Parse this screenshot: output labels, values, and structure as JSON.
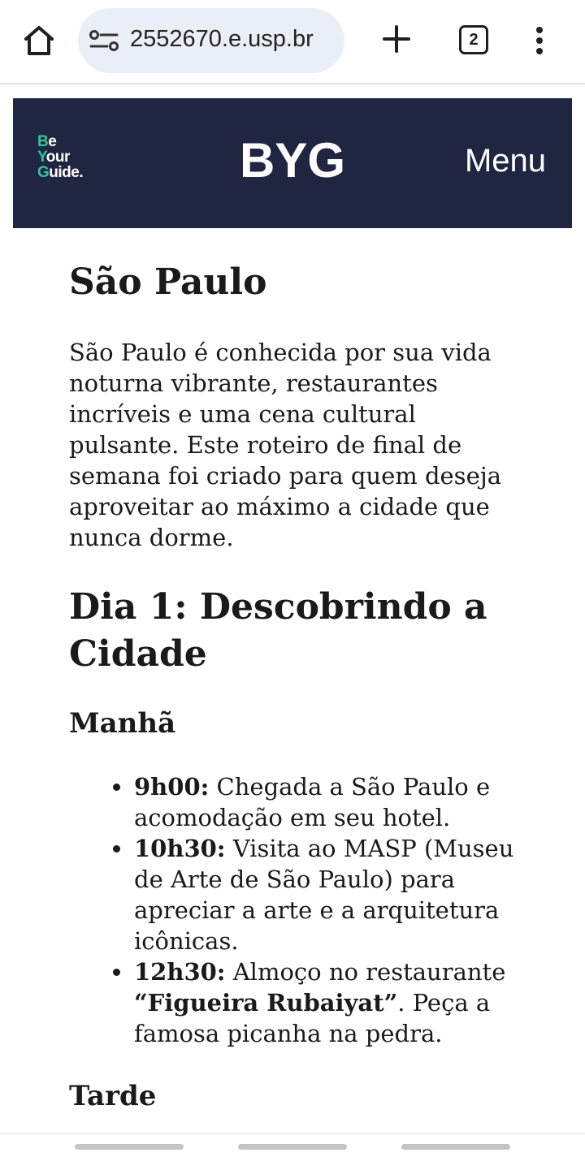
{
  "browser": {
    "url": "2552670.e.usp.br",
    "tab_count": "2"
  },
  "site": {
    "logo_lines": [
      "Be",
      "Your",
      "Guide."
    ],
    "brand": "BYG",
    "menu_label": "Menu",
    "header_color": "#202641",
    "logo_accent": "#2ec79a"
  },
  "article": {
    "title": "São Paulo",
    "intro": "São Paulo é conhecida por sua vida noturna vibrante, restaurantes incríveis e uma cena cultural pulsante. Este roteiro de final de semana foi criado para quem deseja aproveitar ao máximo a cidade que nunca dorme.",
    "day1_heading": "Dia 1: Descobrindo a Cidade",
    "morning_heading": "Manhã",
    "morning_items": [
      {
        "time": "9h00:",
        "text": " Chegada a São Paulo e acomodação em seu hotel."
      },
      {
        "time": "10h30:",
        "text": " Visita ao MASP (Museu de Arte de São Paulo) para apreciar a arte e a arquitetura icônicas."
      },
      {
        "time": "12h30:",
        "text": " Almoço no restaurante ",
        "highlight": "“Figueira Rubaiyat”",
        "text_after": ". Peça a famosa picanha na pedra."
      }
    ],
    "afternoon_heading": "Tarde"
  },
  "icons": [
    "home-icon",
    "site-info-icon",
    "plus-icon",
    "tabs-icon",
    "more-vert-icon"
  ]
}
